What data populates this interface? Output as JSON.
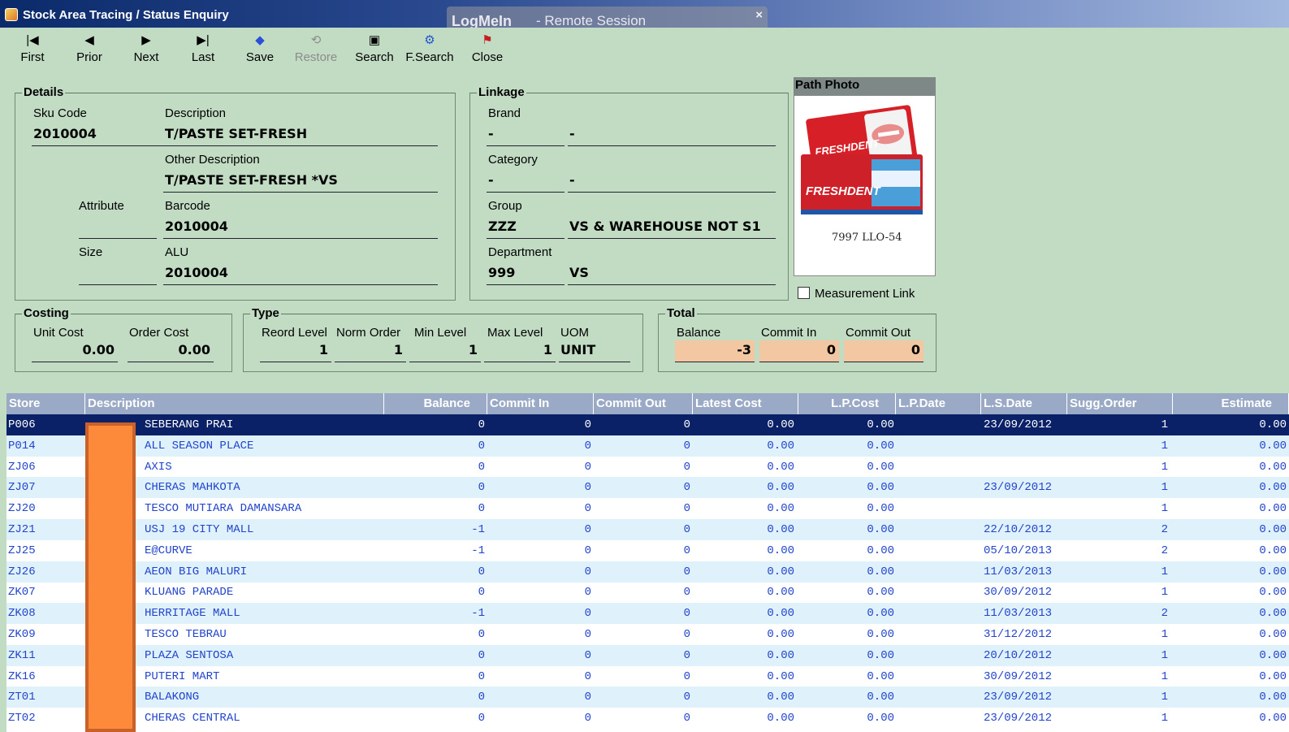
{
  "window": {
    "title": "Stock Area Tracing / Status Enquiry"
  },
  "overlay": {
    "brand": "LogMeIn",
    "subtitle": "- Remote Session",
    "close": "×"
  },
  "toolbar": [
    {
      "label": "First",
      "icon": "first-icon",
      "glyph": "|◀"
    },
    {
      "label": "Prior",
      "icon": "prior-icon",
      "glyph": "◀"
    },
    {
      "label": "Next",
      "icon": "next-icon",
      "glyph": "▶"
    },
    {
      "label": "Last",
      "icon": "last-icon",
      "glyph": "▶|"
    },
    {
      "label": "Save",
      "icon": "save-icon",
      "glyph": "◆"
    },
    {
      "label": "Restore",
      "icon": "restore-icon",
      "glyph": "⟲",
      "disabled": true
    },
    {
      "label": "Search",
      "icon": "search-icon",
      "glyph": "▣"
    },
    {
      "label": "F.Search",
      "icon": "fsearch-icon",
      "glyph": "⚙"
    },
    {
      "label": "Close",
      "icon": "close-icon",
      "glyph": "⚑"
    }
  ],
  "details": {
    "legend": "Details",
    "sku_label": "Sku Code",
    "sku": "2010004",
    "desc_label": "Description",
    "desc": "T/PASTE SET-FRESH",
    "other_label": "Other Description",
    "other": "T/PASTE SET-FRESH *VS",
    "attribute_label": "Attribute",
    "barcode_label": "Barcode",
    "barcode": "2010004",
    "size_label": "Size",
    "alu_label": "ALU",
    "alu": "2010004"
  },
  "linkage": {
    "legend": "Linkage",
    "brand_label": "Brand",
    "brand_code": "-",
    "brand_name": "-",
    "category_label": "Category",
    "category_code": "-",
    "category_name": "-",
    "group_label": "Group",
    "group_code": "ZZZ",
    "group_name": "VS & WAREHOUSE NOT S1",
    "department_label": "Department",
    "department_code": "999",
    "department_name": "VS"
  },
  "photo": {
    "header": "Path Photo",
    "caption": "7997 LLO-54",
    "product_a": "FRESHDENT",
    "product_b": "FRESHDENT"
  },
  "measurement_link": "Measurement Link",
  "costing": {
    "legend": "Costing",
    "unit_cost_label": "Unit Cost",
    "unit_cost": "0.00",
    "order_cost_label": "Order Cost",
    "order_cost": "0.00"
  },
  "type": {
    "legend": "Type",
    "reord_label": "Reord Level",
    "reord": "1",
    "norm_label": "Norm Order",
    "norm": "1",
    "min_label": "Min Level",
    "min": "1",
    "max_label": "Max Level",
    "max": "1",
    "uom_label": "UOM",
    "uom": "UNIT"
  },
  "total": {
    "legend": "Total",
    "balance_label": "Balance",
    "balance": "-3",
    "commit_in_label": "Commit In",
    "commit_in": "0",
    "commit_out_label": "Commit Out",
    "commit_out": "0"
  },
  "grid": {
    "columns": [
      "Store",
      "Description",
      "Balance",
      "Commit In",
      "Commit Out",
      "Latest Cost",
      "L.P.Cost",
      "L.P.Date",
      "L.S.Date",
      "Sugg.Order",
      "Estimate"
    ],
    "rows": [
      [
        "P006",
        "SEBERANG PRAI",
        "0",
        "0",
        "0",
        "0.00",
        "0.00",
        "",
        "23/09/2012",
        "1",
        "0.00"
      ],
      [
        "P014",
        "ALL SEASON PLACE",
        "0",
        "0",
        "0",
        "0.00",
        "0.00",
        "",
        "",
        "1",
        "0.00"
      ],
      [
        "ZJ06",
        "AXIS",
        "0",
        "0",
        "0",
        "0.00",
        "0.00",
        "",
        "",
        "1",
        "0.00"
      ],
      [
        "ZJ07",
        "CHERAS MAHKOTA",
        "0",
        "0",
        "0",
        "0.00",
        "0.00",
        "",
        "23/09/2012",
        "1",
        "0.00"
      ],
      [
        "ZJ20",
        "TESCO MUTIARA DAMANSARA",
        "0",
        "0",
        "0",
        "0.00",
        "0.00",
        "",
        "",
        "1",
        "0.00"
      ],
      [
        "ZJ21",
        "USJ 19 CITY MALL",
        "-1",
        "0",
        "0",
        "0.00",
        "0.00",
        "",
        "22/10/2012",
        "2",
        "0.00"
      ],
      [
        "ZJ25",
        "E@CURVE",
        "-1",
        "0",
        "0",
        "0.00",
        "0.00",
        "",
        "05/10/2013",
        "2",
        "0.00"
      ],
      [
        "ZJ26",
        "AEON BIG MALURI",
        "0",
        "0",
        "0",
        "0.00",
        "0.00",
        "",
        "11/03/2013",
        "1",
        "0.00"
      ],
      [
        "ZK07",
        "KLUANG PARADE",
        "0",
        "0",
        "0",
        "0.00",
        "0.00",
        "",
        "30/09/2012",
        "1",
        "0.00"
      ],
      [
        "ZK08",
        "HERRITAGE MALL",
        "-1",
        "0",
        "0",
        "0.00",
        "0.00",
        "",
        "11/03/2013",
        "2",
        "0.00"
      ],
      [
        "ZK09",
        "TESCO TEBRAU",
        "0",
        "0",
        "0",
        "0.00",
        "0.00",
        "",
        "31/12/2012",
        "1",
        "0.00"
      ],
      [
        "ZK11",
        "PLAZA SENTOSA",
        "0",
        "0",
        "0",
        "0.00",
        "0.00",
        "",
        "20/10/2012",
        "1",
        "0.00"
      ],
      [
        "ZK16",
        "PUTERI MART",
        "0",
        "0",
        "0",
        "0.00",
        "0.00",
        "",
        "30/09/2012",
        "1",
        "0.00"
      ],
      [
        "ZT01",
        "BALAKONG",
        "0",
        "0",
        "0",
        "0.00",
        "0.00",
        "",
        "23/09/2012",
        "1",
        "0.00"
      ],
      [
        "ZT02",
        "CHERAS CENTRAL",
        "0",
        "0",
        "0",
        "0.00",
        "0.00",
        "",
        "23/09/2012",
        "1",
        "0.00"
      ]
    ]
  },
  "colors": {
    "background": "#c2dcc4",
    "grid_header": "#9aaac6",
    "selected_row": "#0a2167",
    "row_text": "#2244cc",
    "alt_row": "#dff1fa",
    "redaction": "#fd8a3a"
  }
}
